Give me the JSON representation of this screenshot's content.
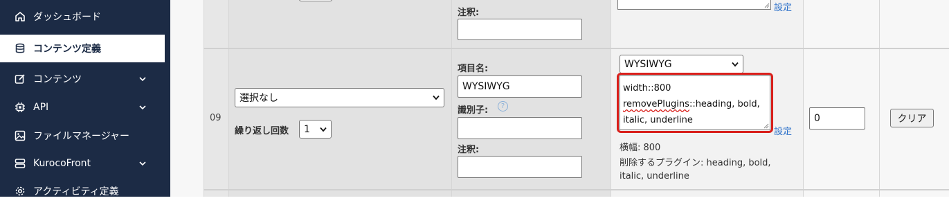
{
  "sidebar": {
    "items": [
      {
        "label": "ダッシュボード",
        "icon": "home-icon",
        "active": false,
        "chevron": false
      },
      {
        "label": "コンテンツ定義",
        "icon": "database-icon",
        "active": true,
        "chevron": false
      },
      {
        "label": "コンテンツ",
        "icon": "edit-icon",
        "active": false,
        "chevron": true
      },
      {
        "label": "API",
        "icon": "chip-icon",
        "active": false,
        "chevron": true
      },
      {
        "label": "ファイルマネージャー",
        "icon": "image-icon",
        "active": false,
        "chevron": false
      },
      {
        "label": "KurocoFront",
        "icon": "layers-icon",
        "active": false,
        "chevron": true
      },
      {
        "label": "アクティビティ定義",
        "icon": "gear-icon",
        "active": false,
        "chevron": false
      }
    ]
  },
  "prev_row": {
    "note_label": "注釈:",
    "note_value": "",
    "settings_link": "設定"
  },
  "row": {
    "number": "09",
    "type_select": "選択なし",
    "repeat_label": "繰り返し回数",
    "repeat_value": "1",
    "name_label": "項目名:",
    "name_value": "WYSIWYG",
    "id_label": "識別子:",
    "id_help": "?",
    "id_value": "",
    "note_label": "注釈:",
    "note_value": "",
    "editor_select": "WYSIWYG",
    "options_lines": [
      "width::800",
      "removePlugins",
      "::heading, bold,",
      "italic, underline"
    ],
    "settings_link": "設定",
    "summary": {
      "line1": "横幅: 800",
      "line2": "削除するプラグイン: heading, bold,",
      "line3": "italic, underline"
    },
    "order_value": "0",
    "clear_button": "クリア"
  },
  "colors": {
    "sidebar_bg": "#1c2b45",
    "highlight": "#d9201c",
    "link": "#2a6fc9"
  }
}
